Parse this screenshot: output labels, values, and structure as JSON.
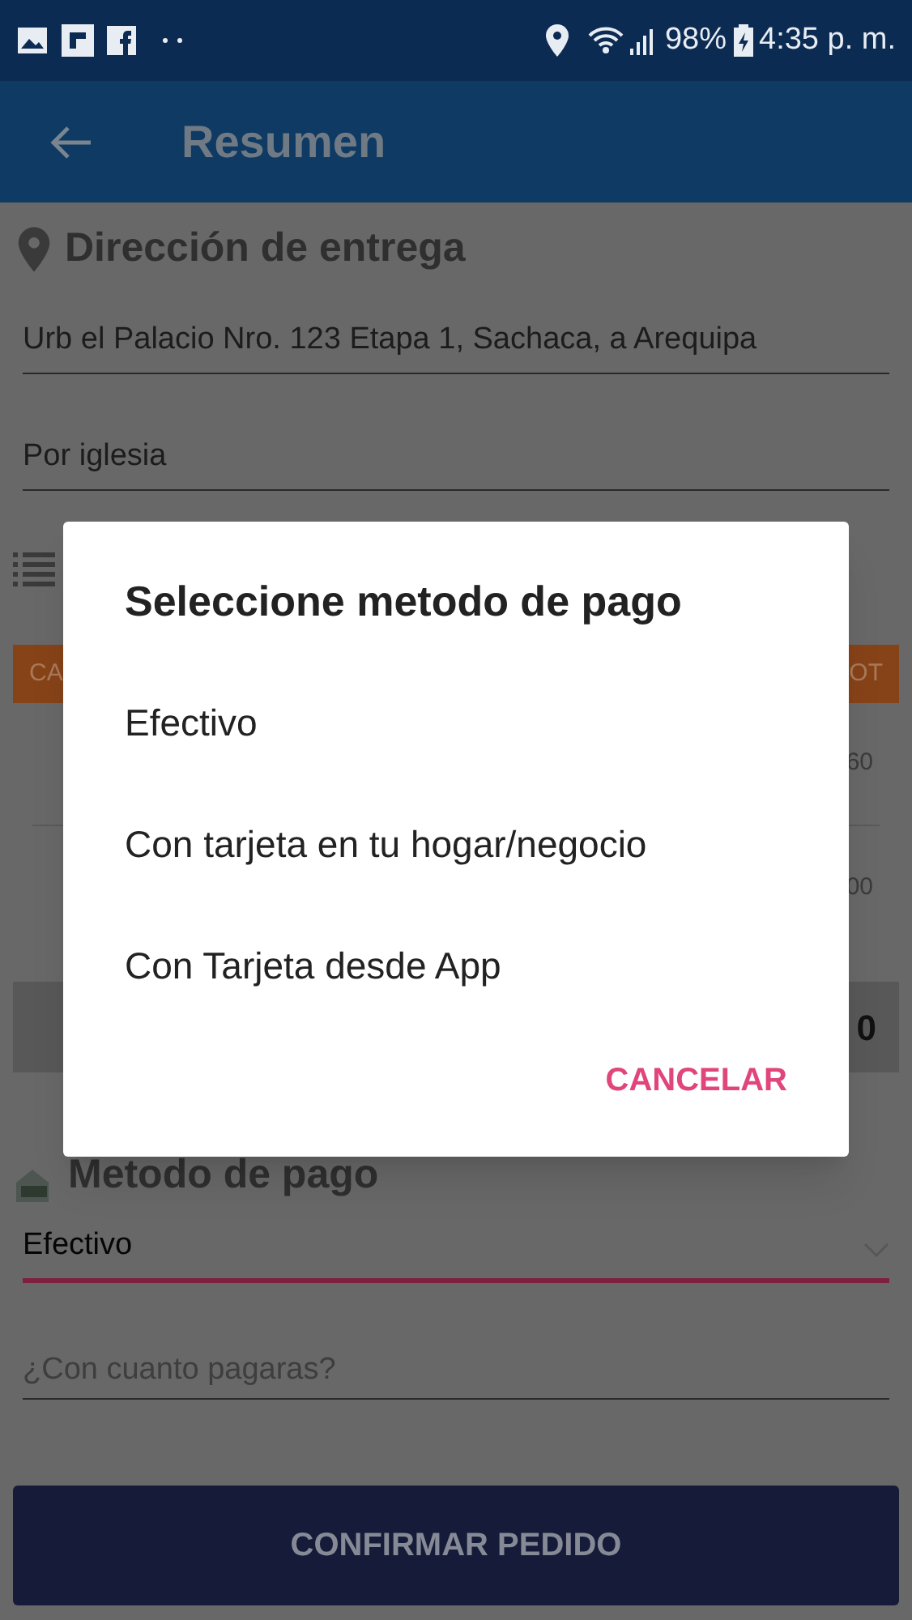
{
  "status_bar": {
    "battery": "98%",
    "time": "4:35 p. m."
  },
  "app_bar": {
    "title": "Resumen"
  },
  "delivery": {
    "heading": "Dirección de entrega",
    "address": "Urb el Palacio Nro. 123 Etapa 1, Sachaca, a Arequipa",
    "reference": "Por iglesia"
  },
  "order": {
    "header_left": "CA",
    "header_right": "OT",
    "rows": [
      "60",
      "00"
    ],
    "total": "0"
  },
  "payment": {
    "heading": "Metodo de pago",
    "method": "Efectivo",
    "amount_placeholder": "¿Con cuanto pagaras?"
  },
  "confirm_button": "CONFIRMAR PEDIDO",
  "dialog": {
    "title": "Seleccione metodo de pago",
    "options": [
      {
        "label": "Efectivo"
      },
      {
        "label": "Con tarjeta en tu hogar/negocio"
      },
      {
        "label": "Con Tarjeta desde App"
      }
    ],
    "cancel": "CANCELAR"
  }
}
